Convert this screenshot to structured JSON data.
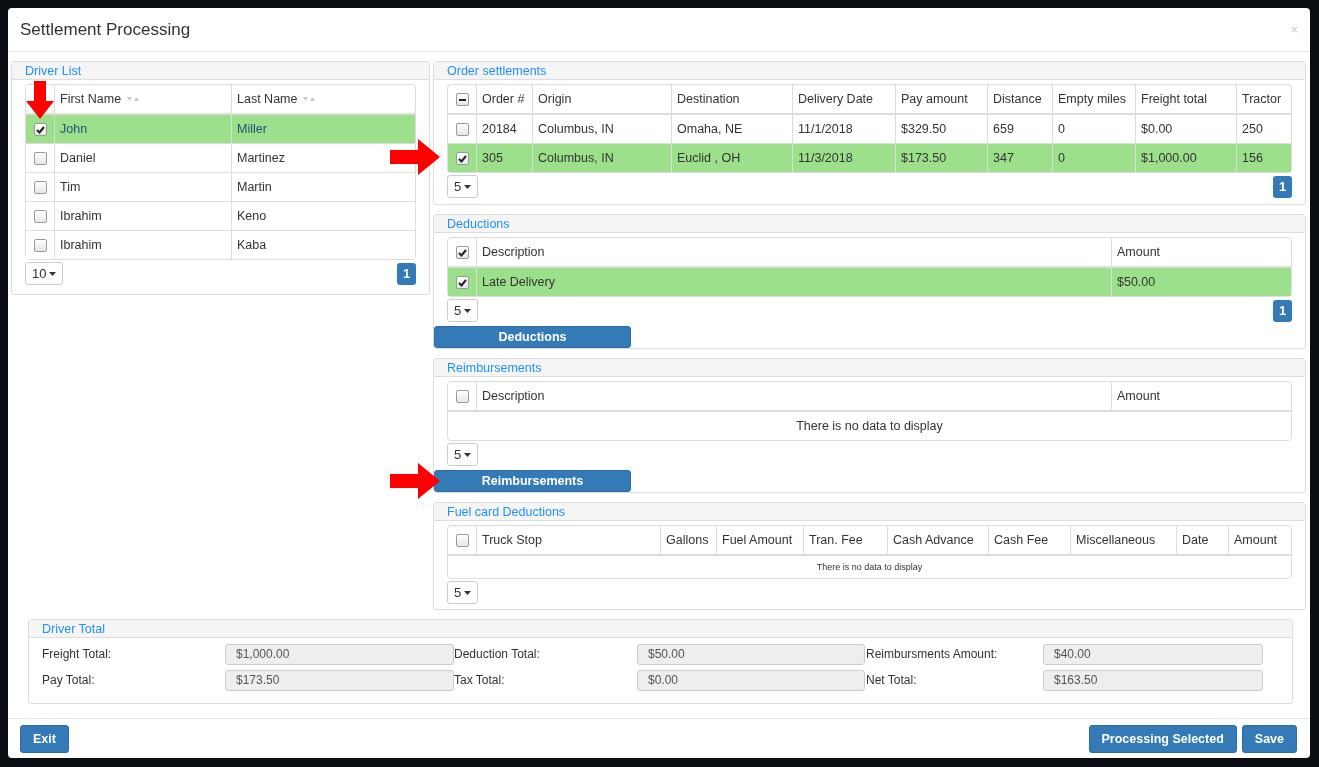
{
  "title": "Settlement Processing",
  "close": "×",
  "driver_list": {
    "title": "Driver List",
    "columns": [
      {
        "label": "First Name",
        "sortable": true
      },
      {
        "label": "Last Name",
        "sortable": true
      }
    ],
    "rows": [
      {
        "cells": [
          "John",
          "Miller"
        ],
        "selected": true,
        "annotated": true
      },
      {
        "cells": [
          "Daniel",
          "Martinez"
        ],
        "selected": false
      },
      {
        "cells": [
          "Tim",
          "Martin"
        ],
        "selected": false
      },
      {
        "cells": [
          "Ibrahim",
          "Keno"
        ],
        "selected": false
      },
      {
        "cells": [
          "Ibrahim",
          "Kaba"
        ],
        "selected": false
      }
    ],
    "page_size": "10",
    "page": "1"
  },
  "order_settlements": {
    "title": "Order settlements",
    "header_partial": true,
    "columns": [
      {
        "label": "Order #"
      },
      {
        "label": "Origin"
      },
      {
        "label": "Destination"
      },
      {
        "label": "Delivery Date"
      },
      {
        "label": "Pay amount"
      },
      {
        "label": "Distance"
      },
      {
        "label": "Empty miles"
      },
      {
        "label": "Freight total"
      },
      {
        "label": "Tractor"
      }
    ],
    "rows": [
      {
        "cells": [
          "20184",
          "Columbus, IN",
          "Omaha, NE",
          "11/1/2018",
          "$329.50",
          "659",
          "0",
          "$0.00",
          "250"
        ],
        "selected": false
      },
      {
        "cells": [
          "305",
          "Columbus, IN",
          "Euclid , OH",
          "11/3/2018",
          "$173.50",
          "347",
          "0",
          "$1,000.00",
          "156"
        ],
        "selected": true,
        "annotated": true
      }
    ],
    "page_size": "5",
    "page": "1"
  },
  "deductions": {
    "title": "Deductions",
    "header_checked": true,
    "columns": [
      {
        "label": "Description"
      },
      {
        "label": "Amount"
      }
    ],
    "rows": [
      {
        "cells": [
          "Late Delivery",
          "$50.00"
        ],
        "selected": true
      }
    ],
    "page_size": "5",
    "page": "1",
    "action": {
      "label": "Deductions"
    }
  },
  "reimbursements": {
    "title": "Reimbursements",
    "header_checked": false,
    "columns": [
      {
        "label": "Description"
      },
      {
        "label": "Amount"
      }
    ],
    "empty_message": "There is no data to display",
    "message_small": false,
    "page_size": "5",
    "action": {
      "label": "Reimbursements",
      "annotated": true
    }
  },
  "fuel_card_deductions": {
    "title": "Fuel card Deductions",
    "header_checked": false,
    "columns": [
      {
        "label": "Truck Stop"
      },
      {
        "label": "Gallons"
      },
      {
        "label": "Fuel Amount"
      },
      {
        "label": "Tran. Fee"
      },
      {
        "label": "Cash Advance"
      },
      {
        "label": "Cash Fee"
      },
      {
        "label": "Miscellaneous"
      },
      {
        "label": "Date"
      },
      {
        "label": "Amount"
      }
    ],
    "empty_message": "There is no data to display",
    "message_small": true,
    "page_size": "5"
  },
  "driver_total": {
    "title": "Driver Total",
    "fields": [
      {
        "label": "Freight Total:",
        "value": "$1,000.00"
      },
      {
        "label": "Deduction Total:",
        "value": "$50.00"
      },
      {
        "label": "Reimbursments Amount:",
        "value": "$40.00"
      },
      {
        "label": "Pay Total:",
        "value": "$173.50"
      },
      {
        "label": "Tax Total:",
        "value": "$0.00"
      },
      {
        "label": "Net Total:",
        "value": "$163.50"
      }
    ]
  },
  "footer": {
    "left_buttons": [
      "Exit"
    ],
    "right_buttons": [
      "Processing Selected",
      "Save"
    ]
  }
}
